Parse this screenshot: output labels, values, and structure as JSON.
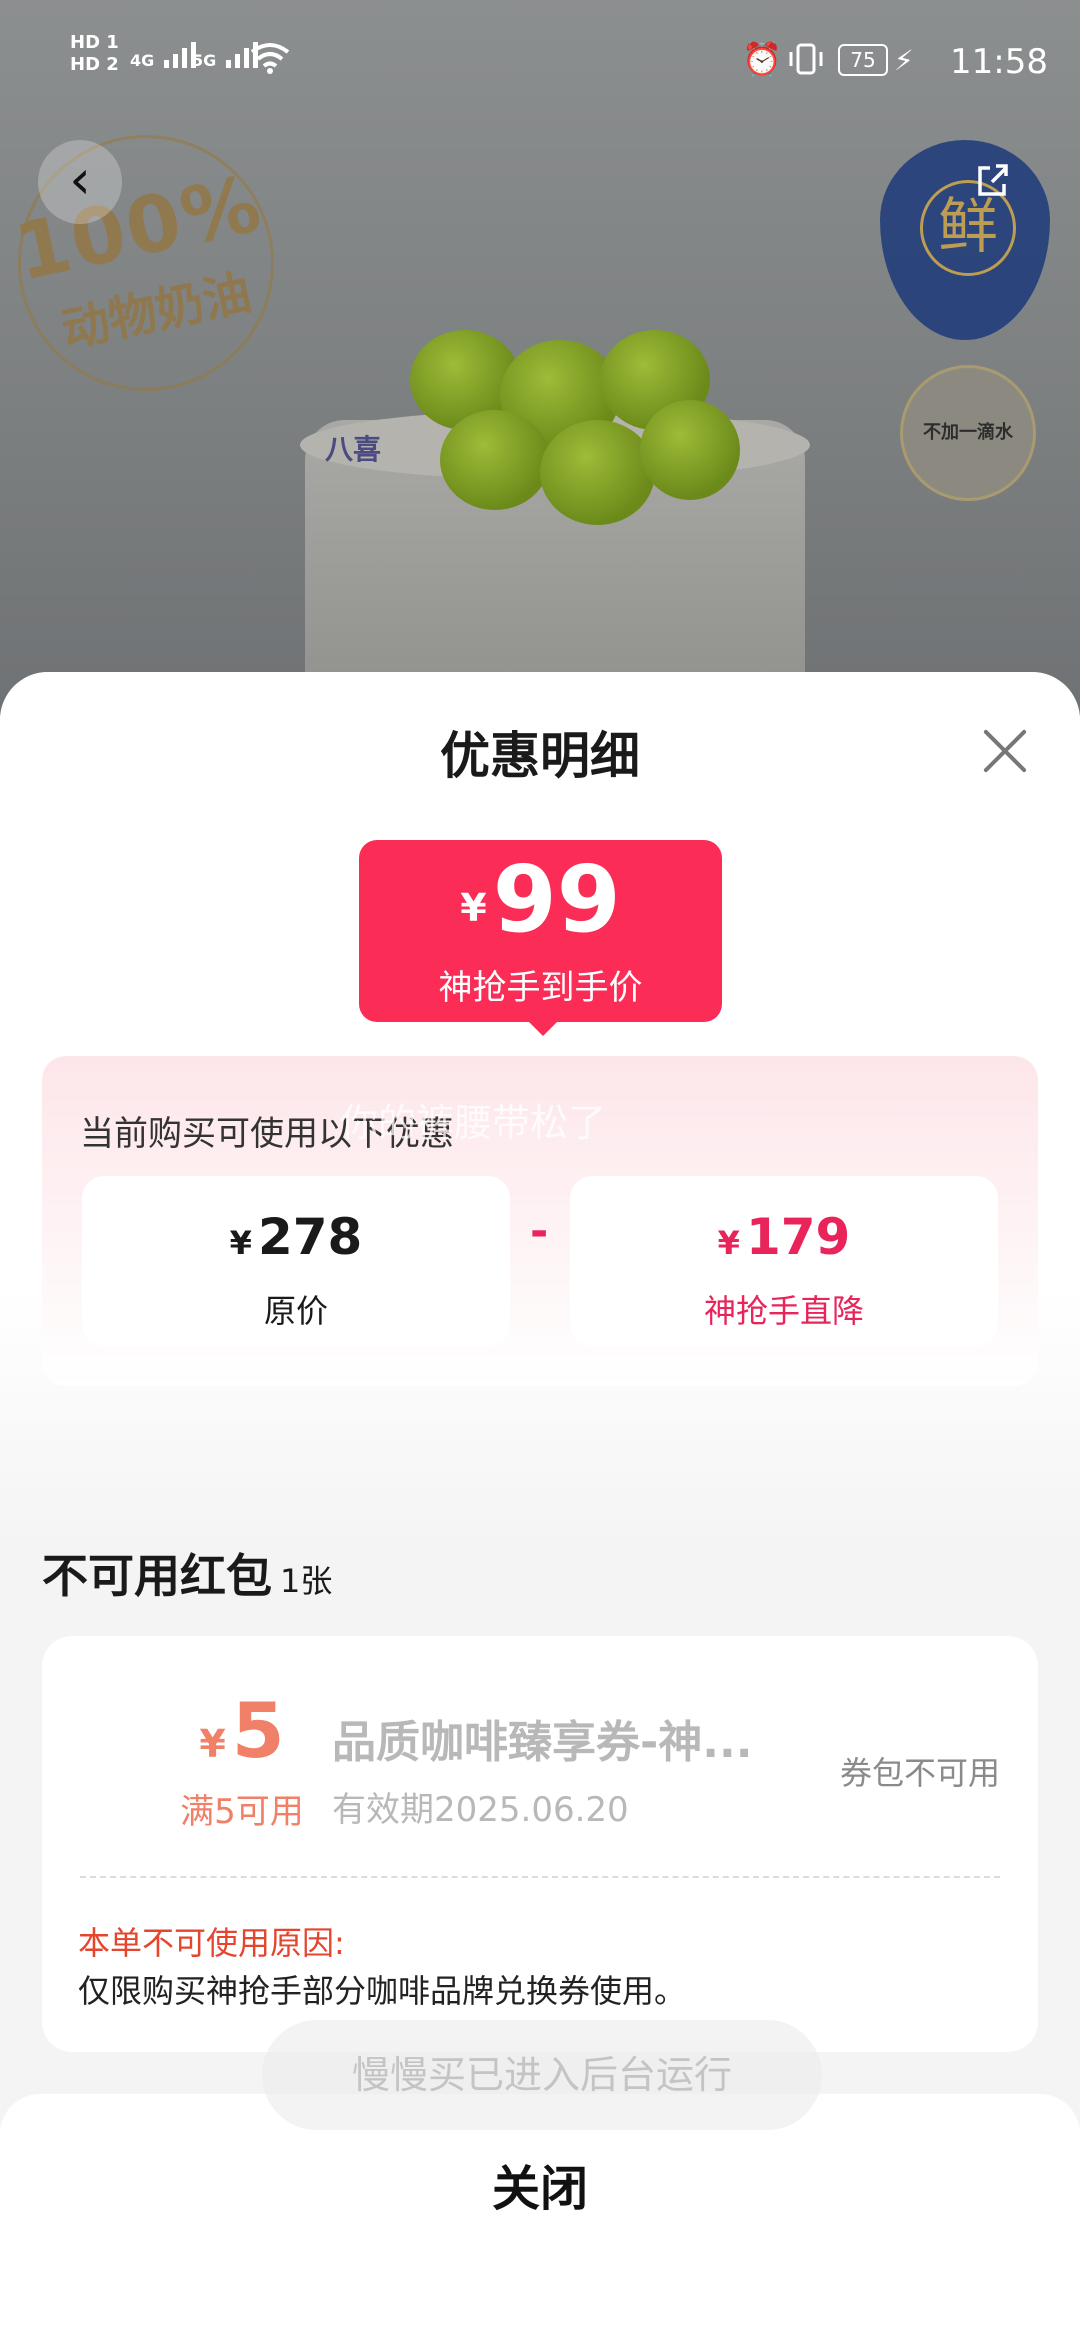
{
  "status_bar": {
    "hd1": "HD 1",
    "hd2": "HD 2",
    "net1": "4G",
    "net2": "5G",
    "battery": "75",
    "time": "11:58"
  },
  "background": {
    "stamp_line1": "100%",
    "stamp_line2": "动物奶油",
    "fresh_char": "鲜",
    "water_badge": "不加一滴水",
    "brand": "八喜"
  },
  "sheet": {
    "title": "优惠明细",
    "final_price": {
      "currency": "¥",
      "amount": "99",
      "label": "神抢手到手价"
    },
    "hint": "当前购买可使用以下优惠",
    "original": {
      "currency": "¥",
      "amount": "278",
      "label": "原价"
    },
    "operator": "-",
    "discount": {
      "currency": "¥",
      "amount": "179",
      "label": "神抢手直降"
    },
    "watermark": "你的裤腰带松了",
    "unavailable_title": "不可用红包",
    "unavailable_count": "1张",
    "coupon": {
      "currency": "¥",
      "amount": "5",
      "condition": "满5可用",
      "name": "品质咖啡臻享券-神...",
      "validity": "有效期2025.06.20",
      "status": "券包不可用",
      "reason_heading": "本单不可使用原因:",
      "reason": "仅限购买神抢手部分咖啡品牌兑换券使用。"
    }
  },
  "toast": "慢慢买已进入后台运行",
  "bottom": {
    "close_label": "关闭"
  },
  "colors": {
    "accent": "#fb2c56",
    "discount_text": "#e8245a",
    "coupon_amount": "#f08068",
    "reason_heading": "#e5452d"
  },
  "icons": [
    "back-icon",
    "share-icon",
    "close-icon",
    "wifi-icon",
    "alarm-icon",
    "vibrate-icon",
    "battery-icon"
  ]
}
